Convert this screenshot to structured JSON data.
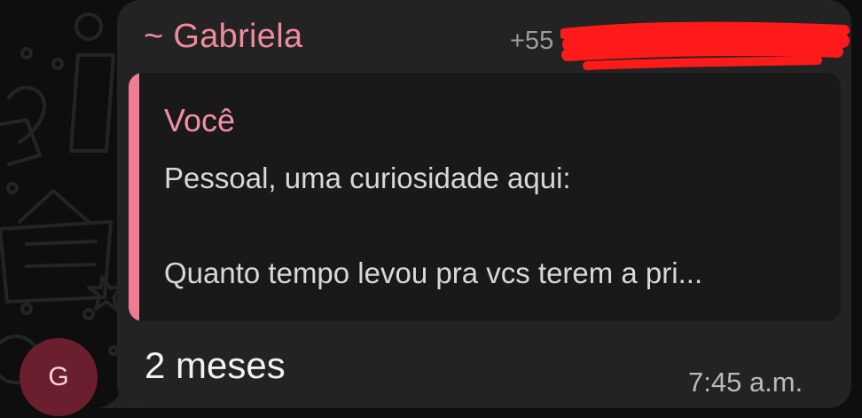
{
  "message": {
    "sender_name": "~ Gabriela",
    "sender_phone": "+55",
    "avatar_initial": "G",
    "quoted": {
      "author": "Você",
      "line1": "Pessoal, uma curiosidade aqui:",
      "line2": "Quanto tempo levou pra vcs terem a pri..."
    },
    "text": "2 meses",
    "time": "7:45 a.m."
  },
  "colors": {
    "background": "#0e0e0e",
    "bubble": "#232323",
    "quote_background": "#191919",
    "accent_pink": "#f07c94",
    "avatar": "#6b1f2e",
    "redaction": "#ff1a1a"
  }
}
